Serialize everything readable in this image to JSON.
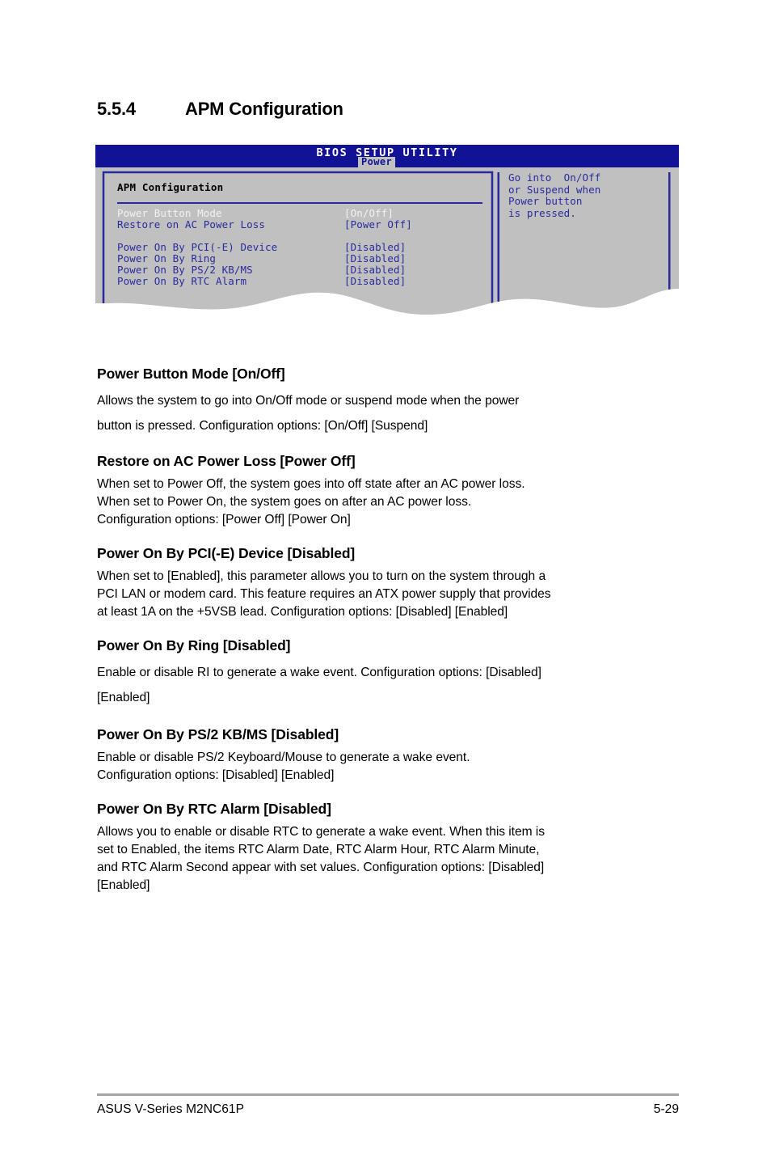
{
  "section": {
    "number": "5.5.4",
    "title": "APM Configuration"
  },
  "bios": {
    "utility_title": "BIOS SETUP UTILITY",
    "active_tab": "Power",
    "panel_heading": "APM Configuration",
    "rows": [
      {
        "label": "Power Button Mode",
        "value": "[On/Off]",
        "selected": true
      },
      {
        "label": "Restore on AC Power Loss",
        "value": "[Power Off]",
        "selected": false
      },
      {
        "label": "Power On By PCI(-E) Device",
        "value": "[Disabled]",
        "selected": false
      },
      {
        "label": "Power On By Ring",
        "value": "[Disabled]",
        "selected": false
      },
      {
        "label": "Power On By PS/2 KB/MS",
        "value": "[Disabled]",
        "selected": false
      },
      {
        "label": "Power On By RTC Alarm",
        "value": "[Disabled]",
        "selected": false
      }
    ],
    "help_text": "Go into  On/Off\nor Suspend when\nPower button\nis pressed.",
    "colors": {
      "titlebar": "#121296",
      "panel_bg": "#c0c0c0",
      "text_blue": "#2a2a9e",
      "text_selected": "#f2f2f2"
    }
  },
  "items": [
    {
      "title": "Power Button Mode [On/Off]",
      "body": "Allows the system to go into On/Off mode or suspend mode when the power\nbutton is pressed. Configuration options: [On/Off] [Suspend]"
    },
    {
      "title": "Restore on AC Power Loss [Power Off]",
      "body": "When set to Power Off, the system goes into off state after an AC power loss.\nWhen set to Power On, the system goes on after an AC power loss.\nConfiguration options: [Power Off] [Power On]"
    },
    {
      "title": "Power On By PCI(-E) Device [Disabled]",
      "body": "When set to [Enabled], this parameter allows you to turn on the system through a\nPCI LAN or modem card. This feature requires an ATX power supply that provides\nat least 1A on the +5VSB lead. Configuration options: [Disabled] [Enabled]"
    },
    {
      "title": "Power On By Ring [Disabled]",
      "body": "Enable or disable RI to generate a wake event. Configuration options: [Disabled]\n[Enabled]"
    },
    {
      "title": "Power On By PS/2 KB/MS [Disabled]",
      "body": "Enable or disable PS/2 Keyboard/Mouse to generate a wake event.\nConfiguration options: [Disabled] [Enabled]"
    },
    {
      "title": "Power On By RTC Alarm [Disabled]",
      "body": "Allows you to enable or disable RTC to generate a wake event. When this item is\nset to Enabled, the items RTC Alarm Date, RTC Alarm Hour, RTC Alarm Minute,\nand RTC Alarm Second appear with set values. Configuration options: [Disabled]\n[Enabled]"
    }
  ],
  "footer": {
    "left": "ASUS V-Series M2NC61P",
    "right": "5-29"
  }
}
